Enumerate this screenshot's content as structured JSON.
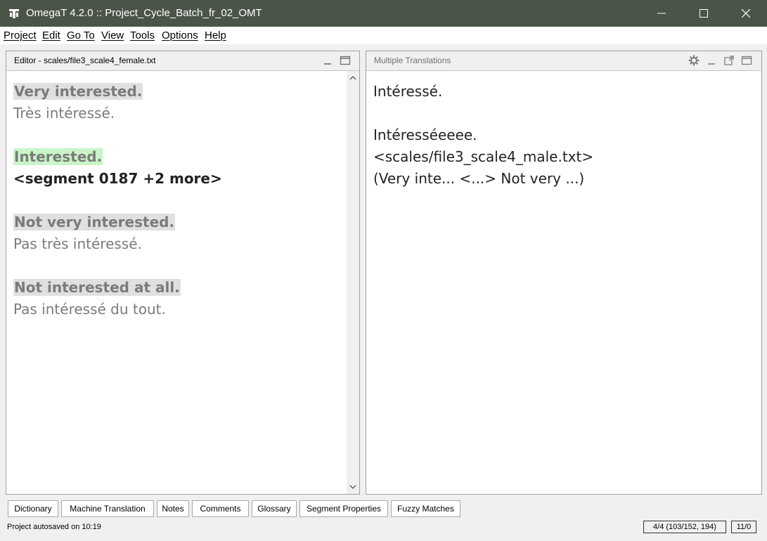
{
  "window": {
    "title": "OmegaT 4.2.0 :: Project_Cycle_Batch_fr_02_OMT",
    "icon": "omegat-logo-icon"
  },
  "menu": [
    "Project",
    "Edit",
    "Go To",
    "View",
    "Tools",
    "Options",
    "Help"
  ],
  "editor": {
    "title": "Editor - scales/file3_scale4_female.txt",
    "segments": [
      {
        "source": "Very interested.",
        "target": "Très intéressé."
      },
      {
        "source": "Interested.",
        "target": "<segment 0187 +2 more>",
        "active": true
      },
      {
        "source": "Not very interested.",
        "target": "Pas très intéressé."
      },
      {
        "source": "Not interested at all.",
        "target": "Pas intéressé du tout."
      }
    ]
  },
  "multiple_translations": {
    "title": "Multiple Translations",
    "lines": [
      "Intéressé.",
      "",
      "Intéresséeeee.",
      "<scales/file3_scale4_male.txt>",
      "(Very inte... <...> Not very ...)"
    ]
  },
  "bottom_tabs": [
    "Dictionary",
    "Machine Translation",
    "Notes",
    "Comments",
    "Glossary",
    "Segment Properties",
    "Fuzzy Matches"
  ],
  "status": {
    "message": "Project autosaved on 10:19",
    "progress": "4/4 (103/152, 194)",
    "chars": "11/0"
  },
  "colors": {
    "titlebar": "#4a5548",
    "active_source_bg": "#c9f5c9",
    "source_bg": "#e0e0e0"
  }
}
